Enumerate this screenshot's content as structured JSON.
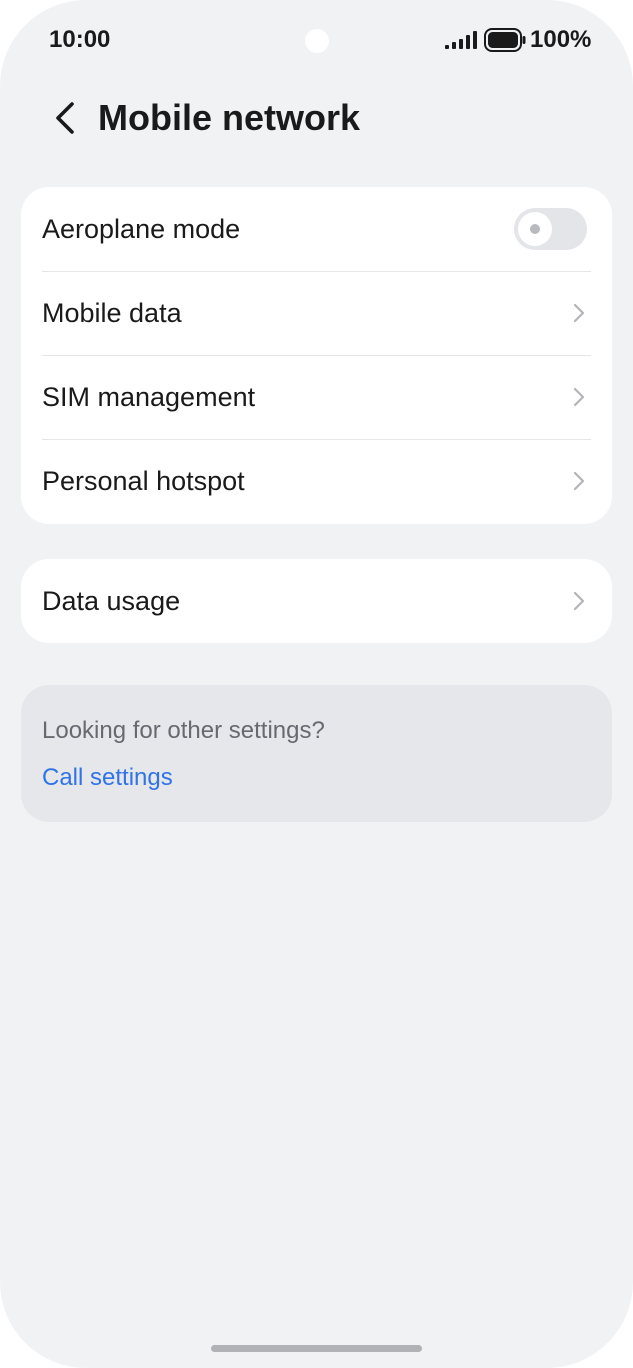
{
  "status_bar": {
    "time": "10:00",
    "battery_percent": "100%",
    "icons": [
      "signal-icon",
      "battery-icon"
    ]
  },
  "header": {
    "title": "Mobile network",
    "back_icon": "back-chevron-icon"
  },
  "main_section": {
    "items": [
      {
        "label": "Aeroplane mode",
        "control": "toggle",
        "enabled": false
      },
      {
        "label": "Mobile data",
        "control": "chevron"
      },
      {
        "label": "SIM management",
        "control": "chevron"
      },
      {
        "label": "Personal hotspot",
        "control": "chevron"
      }
    ]
  },
  "usage_section": {
    "items": [
      {
        "label": "Data usage",
        "control": "chevron"
      }
    ]
  },
  "other_settings": {
    "hint": "Looking for other settings?",
    "link": "Call settings"
  },
  "colors": {
    "background": "#f1f2f4",
    "card": "#ffffff",
    "link": "#2f73e6",
    "text": "#1a1a1a"
  }
}
